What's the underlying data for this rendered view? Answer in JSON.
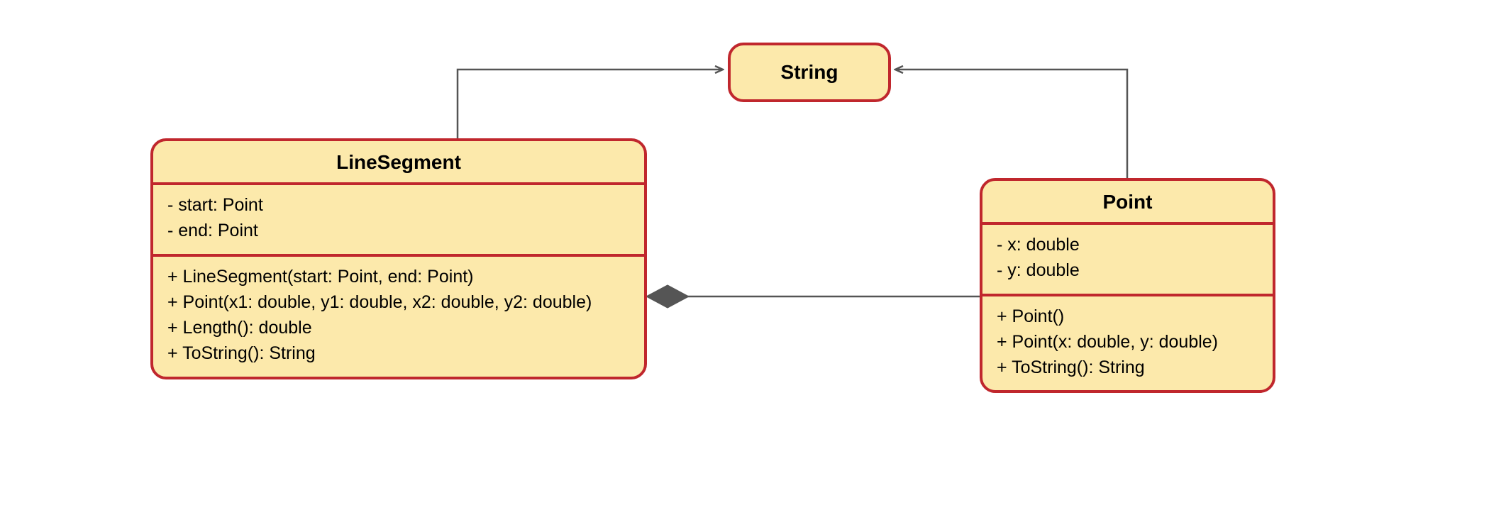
{
  "classes": {
    "string": {
      "name": "String"
    },
    "lineSegment": {
      "name": "LineSegment",
      "attributes": [
        "- start: Point",
        "- end: Point"
      ],
      "methods": [
        "+ LineSegment(start: Point, end: Point)",
        "+ Point(x1: double, y1: double, x2: double, y2: double)",
        "+ Length(): double",
        "+ ToString(): String"
      ]
    },
    "point": {
      "name": "Point",
      "attributes": [
        "- x: double",
        "- y: double"
      ],
      "methods": [
        "+ Point()",
        "+ Point(x: double, y: double)",
        "+ ToString(): String"
      ]
    }
  },
  "relations": [
    {
      "from": "LineSegment",
      "to": "String",
      "type": "dependency"
    },
    {
      "from": "Point",
      "to": "String",
      "type": "dependency"
    },
    {
      "from": "LineSegment",
      "to": "Point",
      "type": "composition"
    }
  ]
}
